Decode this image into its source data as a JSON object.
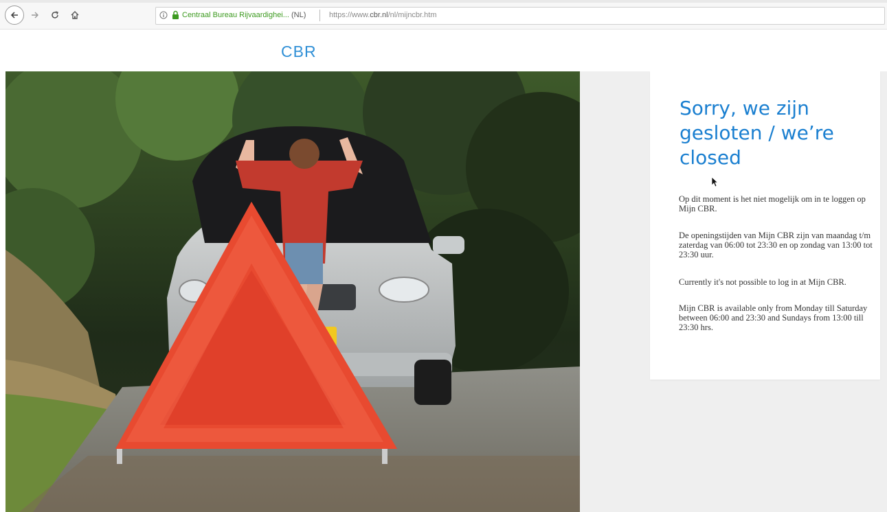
{
  "browser": {
    "site_identity": "Centraal Bureau Rijvaardighei...",
    "site_country": "(NL)",
    "url_prefix": "https://www.",
    "url_domain": "cbr.nl",
    "url_path": "/nl/mijncbr.htm",
    "icons": [
      "back-arrow-icon",
      "forward-arrow-icon",
      "reload-icon",
      "home-icon",
      "info-icon",
      "lock-icon"
    ],
    "secure_color": "#3c9a1f"
  },
  "page": {
    "logo": "CBR",
    "brand_color": "#2f8fd6",
    "hero_image": "woman-with-broken-down-car-and-warning-triangle",
    "card": {
      "title": "Sorry, we zijn gesloten / we’re closed",
      "paragraphs": [
        "Op dit moment is het niet mogelijk om in te loggen op Mijn CBR.",
        "De openingstijden van Mijn CBR zijn van maandag t/m zaterdag van 06:00 tot 23:30 en op zondag van 13:00 tot 23:30 uur.",
        "Currently it's not possible to log in at Mijn CBR.",
        "Mijn CBR is available only from Monday till Saturday between 06:00 and 23:30 and Sundays from 13:00 till 23:30 hrs."
      ]
    }
  }
}
